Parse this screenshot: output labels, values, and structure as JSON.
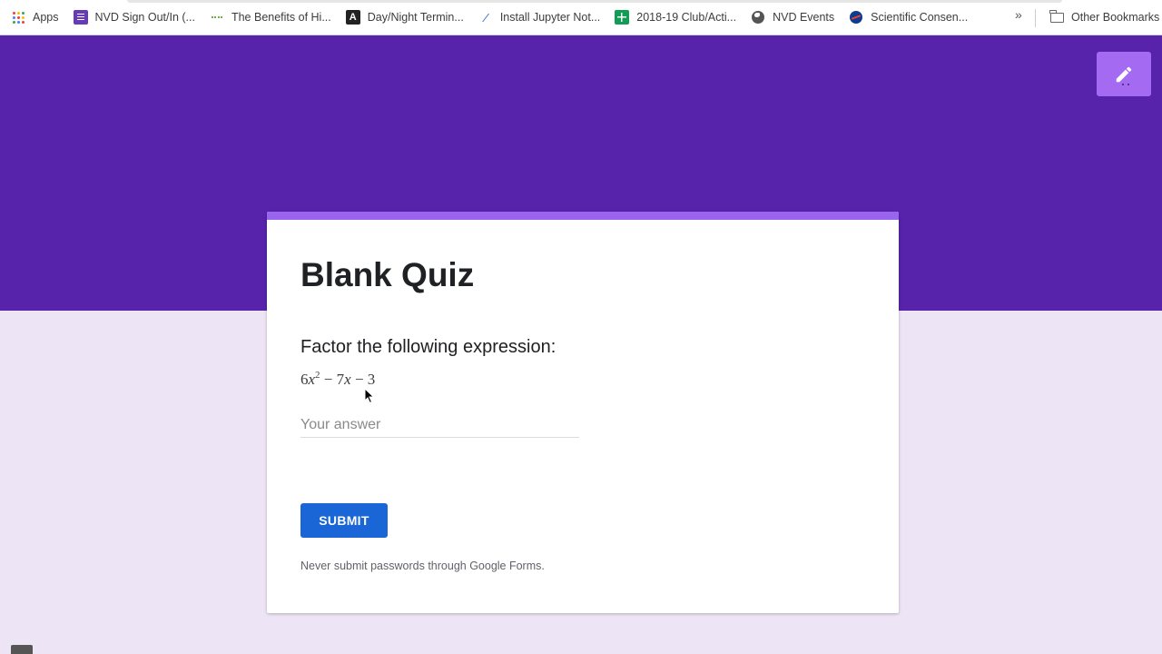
{
  "bookmarks": {
    "apps_label": "Apps",
    "items": [
      {
        "label": "NVD Sign Out/In (...",
        "icon": "google-forms-icon"
      },
      {
        "label": "The Benefits of Hi...",
        "icon": "green-line-icon"
      },
      {
        "label": "Day/Night Termin...",
        "icon": "letter-a-icon"
      },
      {
        "label": "Install Jupyter Not...",
        "icon": "jupyter-icon"
      },
      {
        "label": "2018-19 Club/Acti...",
        "icon": "google-sheets-icon"
      },
      {
        "label": "NVD Events",
        "icon": "globe-icon"
      },
      {
        "label": "Scientific Consen...",
        "icon": "nasa-icon"
      }
    ],
    "more_label": "»",
    "other_label": "Other Bookmarks"
  },
  "form": {
    "title": "Blank Quiz",
    "question": "Factor the following expression:",
    "expression": {
      "coef1": "6",
      "var": "x",
      "exp": "2",
      "rest": " − 7",
      "var2": "x",
      "tail": " − 3"
    },
    "answer_placeholder": "Your answer",
    "submit_label": "SUBMIT",
    "notice": "Never submit passwords through Google Forms."
  },
  "colors": {
    "header": "#5723aa",
    "accent": "#9b64ee",
    "edit_button": "#a56af2",
    "submit": "#1a66d6",
    "page_bg": "#ede5f5"
  }
}
